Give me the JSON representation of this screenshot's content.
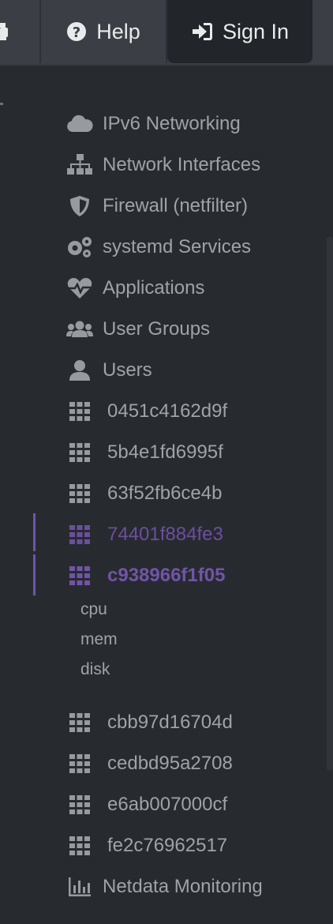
{
  "topbar": {
    "help_label": "Help",
    "signin_label": "Sign In"
  },
  "menu": {
    "items": [
      {
        "label": "IPv6 Networking",
        "icon": "cloud-icon"
      },
      {
        "label": "Network Interfaces",
        "icon": "sitemap-icon"
      },
      {
        "label": "Firewall (netfilter)",
        "icon": "shield-icon"
      },
      {
        "label": "systemd Services",
        "icon": "gears-icon"
      },
      {
        "label": "Applications",
        "icon": "heartbeat-icon"
      },
      {
        "label": "User Groups",
        "icon": "users-icon"
      },
      {
        "label": "Users",
        "icon": "user-icon"
      },
      {
        "label": "0451c4162d9f",
        "icon": "grid-icon"
      },
      {
        "label": "5b4e1fd6995f",
        "icon": "grid-icon"
      },
      {
        "label": "63f52fb6ce4b",
        "icon": "grid-icon"
      },
      {
        "label": "74401f884fe3",
        "icon": "grid-icon"
      },
      {
        "label": "c938966f1f05",
        "icon": "grid-icon"
      },
      {
        "label": "cbb97d16704d",
        "icon": "grid-icon"
      },
      {
        "label": "cedbd95a2708",
        "icon": "grid-icon"
      },
      {
        "label": "e6ab007000cf",
        "icon": "grid-icon"
      },
      {
        "label": "fe2c76962517",
        "icon": "grid-icon"
      },
      {
        "label": "Netdata Monitoring",
        "icon": "bar-chart-icon"
      }
    ],
    "submenu": [
      "cpu",
      "mem",
      "disk"
    ]
  },
  "colors": {
    "background": "#272b30",
    "topbar": "#3b3f45",
    "text": "#9fa2a6",
    "accent": "#7154a8"
  }
}
